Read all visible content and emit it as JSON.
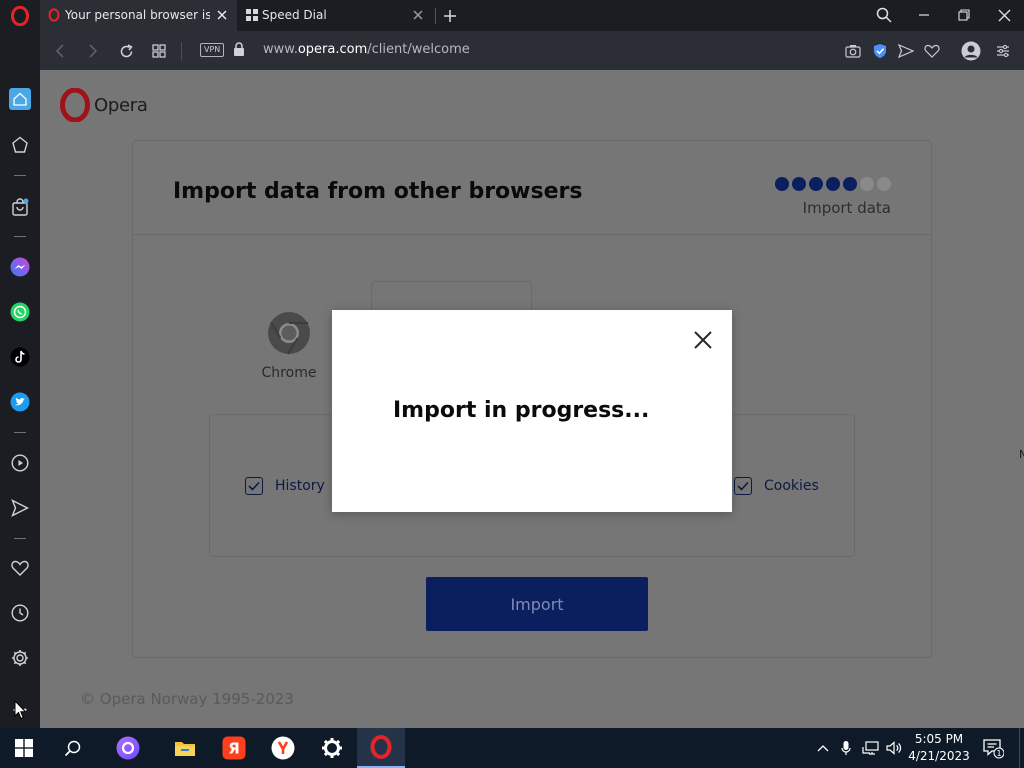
{
  "tabs": [
    {
      "title": "Your personal browser is al",
      "active": true
    },
    {
      "title": "Speed Dial",
      "active": false
    }
  ],
  "address_bar": {
    "vpn_label": "VPN",
    "url_prefix": "www.",
    "url_host": "opera.com",
    "url_path": "/client/welcome"
  },
  "page": {
    "logo_text": "Opera",
    "title": "Import data from other browsers",
    "step_label": "Import data",
    "progress": {
      "filled_steps": 5,
      "total_steps": 7
    },
    "browser_source": "Chrome",
    "options": [
      {
        "label": "History",
        "checked": true
      },
      {
        "label": "Cookies",
        "checked": true
      }
    ],
    "import_button": "Import",
    "copyright": "© Opera Norway 1995-2023"
  },
  "modal": {
    "title": "Import in progress..."
  },
  "taskbar": {
    "time": "5:05 PM",
    "date": "4/21/2023",
    "notification_count": "1"
  },
  "colors": {
    "accent": "#0b1e5e",
    "dot_filled": "#0b1e5e",
    "dot_empty": "#8a8a8a",
    "overlay_bg": "#767676",
    "opera_red": "#cc1b24"
  }
}
